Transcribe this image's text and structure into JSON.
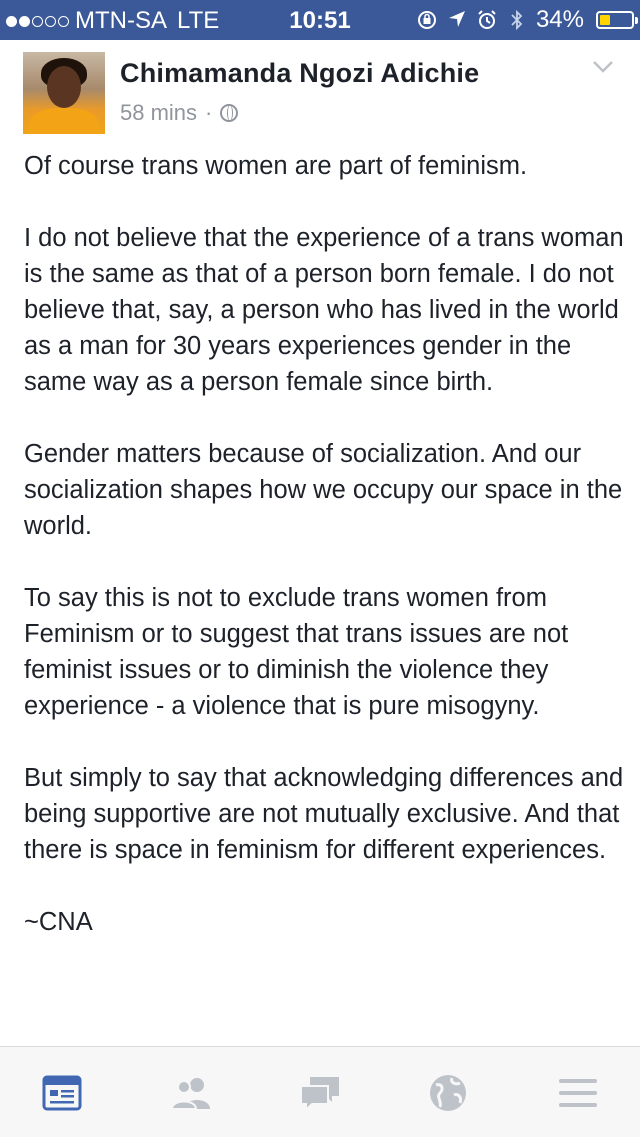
{
  "status_bar": {
    "carrier": "MTN-SA",
    "network": "LTE",
    "time": "10:51",
    "battery_percent": "34%",
    "battery_level": 0.34,
    "signal_bars_filled": 2,
    "signal_bars_total": 5,
    "icons": [
      "lock-rotation-icon",
      "location-arrow-icon",
      "alarm-icon",
      "bluetooth-icon"
    ]
  },
  "post": {
    "author": "Chimamanda Ngozi Adichie",
    "time": "58 mins",
    "separator": "·",
    "privacy_icon": "globe-icon",
    "paragraphs": [
      "Of course trans women are part of feminism.",
      "I do not believe that the experience of a trans woman is the same as that of a person born female. I do not believe that, say, a person who has lived in the world as a man for 30 years experiences gender in the same way as a person female since birth.",
      "Gender matters because of socialization. And our socialization shapes how we occupy our space in the world.",
      "To say this is not to exclude trans women from Feminism or to suggest that trans issues are not feminist issues or to diminish the violence they experience - a violence that is pure misogyny.",
      "But simply to say that acknowledging differences and being supportive are not mutually exclusive. And that there is space in feminism for different experiences.",
      "~CNA"
    ]
  },
  "tabbar": {
    "tabs": [
      {
        "icon": "news-feed-icon",
        "active": true
      },
      {
        "icon": "friends-icon",
        "active": false
      },
      {
        "icon": "messages-icon",
        "active": false
      },
      {
        "icon": "notifications-globe-icon",
        "active": false
      },
      {
        "icon": "menu-icon",
        "active": false
      }
    ]
  },
  "colors": {
    "status_bar_bg": "#3b5998",
    "active_tab": "#4267b2",
    "inactive_tab": "#bec2c9",
    "battery_fill": "#ffd400",
    "meta_text": "#90949c"
  }
}
